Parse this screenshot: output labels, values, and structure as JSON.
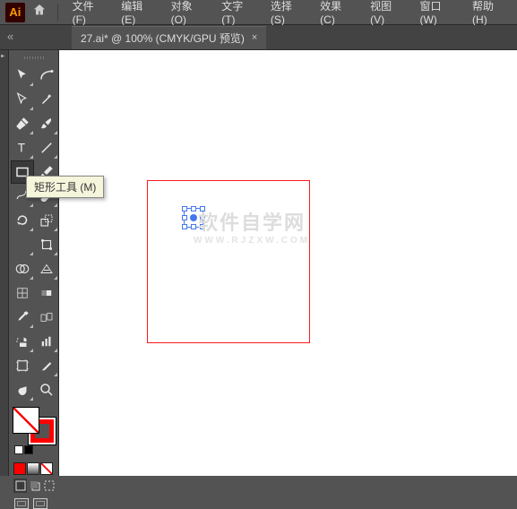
{
  "app": {
    "logo_text": "Ai"
  },
  "menu": {
    "file": "文件(F)",
    "edit": "编辑(E)",
    "object": "对象(O)",
    "type": "文字(T)",
    "select": "选择(S)",
    "effect": "效果(C)",
    "view": "视图(V)",
    "window": "窗口(W)",
    "help": "帮助(H)"
  },
  "tab": {
    "title": "27.ai* @ 100% (CMYK/GPU 预览)",
    "close": "×",
    "back": "«"
  },
  "tooltip": {
    "rectangle": "矩形工具 (M)"
  },
  "watermark": {
    "main": "软件自学网",
    "sub": "WWW.RJZXW.COM"
  },
  "tools": {
    "selection": "选择",
    "direct": "直接选择",
    "magic": "魔棒",
    "lasso": "套索",
    "pen": "钢笔",
    "curvature": "曲率",
    "type": "文字",
    "line": "直线段",
    "rectangle": "矩形",
    "brush": "画笔",
    "shaper": "Shaper",
    "eraser": "橡皮擦",
    "rotate": "旋转",
    "scale": "比例缩放",
    "width": "宽度",
    "free": "自由变换",
    "shape_builder": "形状生成器",
    "perspective": "透视网格",
    "mesh": "网格",
    "gradient": "渐变",
    "eyedropper": "吸管",
    "blend": "混合",
    "symbol": "符号喷枪",
    "graph": "柱形图",
    "artboard": "画板",
    "slice": "切片",
    "hand": "抓手",
    "zoom": "缩放"
  },
  "colors": {
    "fill": "#ffffff",
    "stroke": "#ff0000",
    "row": [
      "#ff0000",
      "#888888",
      "#ffffff"
    ],
    "grad": [
      "#ff0000",
      "#ffff00",
      "#00ff00",
      "#0000ff"
    ]
  }
}
